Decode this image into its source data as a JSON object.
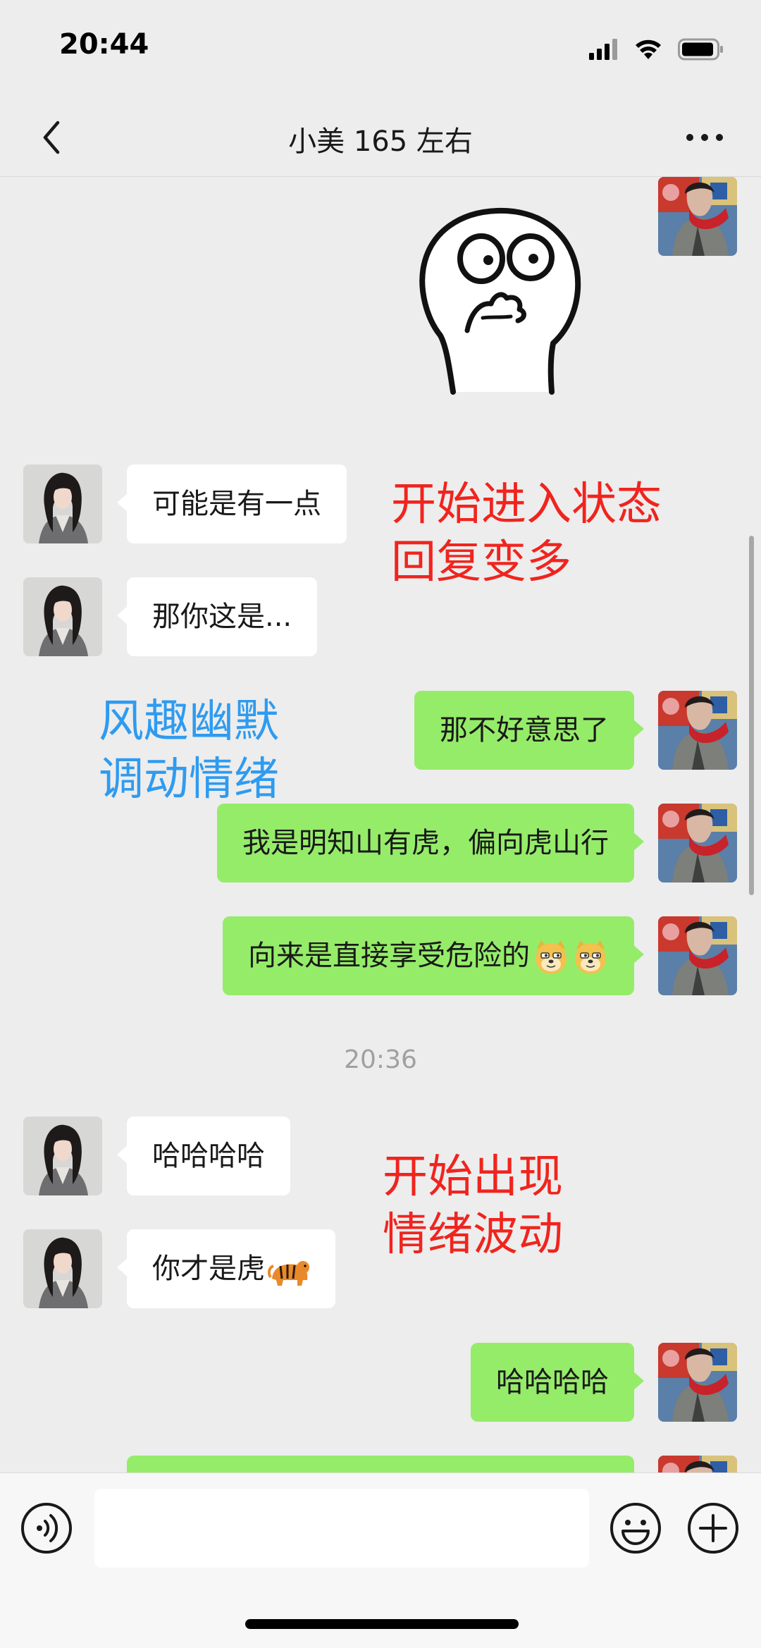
{
  "status_bar": {
    "time": "20:44",
    "battery_level": 0.85
  },
  "header": {
    "title": "小美 165 左右",
    "back_icon": "chevron-left-icon",
    "more_icon": "more-dots-icon"
  },
  "messages": [
    {
      "side": "right",
      "type": "sticker",
      "sticker": "cartoon-face-sticker"
    },
    {
      "side": "left",
      "text": "可能是有一点"
    },
    {
      "side": "left",
      "text": "那你这是..."
    },
    {
      "side": "right",
      "text": "那不好意思了"
    },
    {
      "side": "right",
      "text": "我是明知山有虎，偏向虎山行"
    },
    {
      "side": "right",
      "text": "向来是直接享受危险的",
      "emojis": [
        "doge-emoji",
        "doge-emoji"
      ]
    },
    {
      "type": "time",
      "text": "20:36"
    },
    {
      "side": "left",
      "text": "哈哈哈哈"
    },
    {
      "side": "left",
      "text": "你才是虎",
      "emojis": [
        "tiger-emoji"
      ]
    },
    {
      "side": "right",
      "text": "哈哈哈哈"
    },
    {
      "side": "right",
      "text": ""
    }
  ],
  "annotations": [
    {
      "text": "开始进入状态\n回复变多",
      "color": "#F0241E"
    },
    {
      "text": "风趣幽默\n调动情绪",
      "color": "#2E9BF0"
    },
    {
      "text": "开始出现\n情绪波动",
      "color": "#F0241E"
    }
  ],
  "input_bar": {
    "value": "",
    "placeholder": ""
  },
  "colors": {
    "background": "#EDEDED",
    "bubble_self": "#95EC69",
    "bubble_other": "#FFFFFF"
  }
}
